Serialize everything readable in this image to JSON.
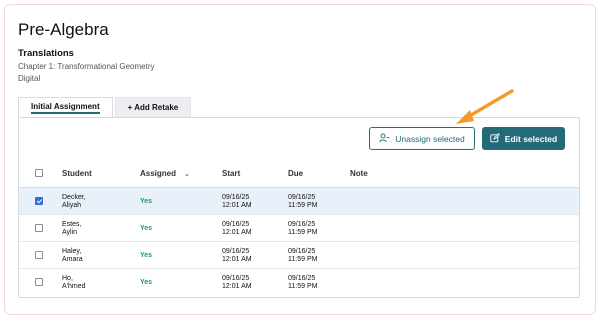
{
  "page": {
    "title": "Pre-Algebra",
    "subtitle": "Translations",
    "chapter": "Chapter 1: Transformational Geometry",
    "mode": "Digital"
  },
  "tabs": [
    {
      "label": "Initial Assignment",
      "active": true
    },
    {
      "label": "+ Add Retake",
      "active": false
    }
  ],
  "actions": {
    "unassign_label": "Unassign selected",
    "edit_label": "Edit selected"
  },
  "table": {
    "headers": {
      "student": "Student",
      "assigned": "Assigned",
      "start": "Start",
      "due": "Due",
      "note": "Note"
    },
    "rows": [
      {
        "name1": "Decker,",
        "name2": "Aliyah",
        "assigned": "Yes",
        "start_date": "09/16/25",
        "start_time": "12:01 AM",
        "due_date": "09/16/25",
        "due_time": "11:59 PM",
        "checked": true
      },
      {
        "name1": "Estes,",
        "name2": "Aylin",
        "assigned": "Yes",
        "start_date": "09/16/25",
        "start_time": "12:01 AM",
        "due_date": "09/16/25",
        "due_time": "11:59 PM",
        "checked": false
      },
      {
        "name1": "Haley,",
        "name2": "Amara",
        "assigned": "Yes",
        "start_date": "09/16/25",
        "start_time": "12:01 AM",
        "due_date": "09/16/25",
        "due_time": "11:59 PM",
        "checked": false
      },
      {
        "name1": "Ho,",
        "name2": "A'hmed",
        "assigned": "Yes",
        "start_date": "09/16/25",
        "start_time": "12:01 AM",
        "due_date": "09/16/25",
        "due_time": "11:59 PM",
        "checked": false
      }
    ]
  },
  "colors": {
    "accent": "#246a78",
    "yes": "#1f9d57",
    "arrow": "#f29a2e",
    "selected_row": "#e8f0f9"
  },
  "icons": {
    "unassign": "person-minus-icon",
    "edit": "edit-pencil-icon",
    "sort": "chevron-down-icon"
  }
}
